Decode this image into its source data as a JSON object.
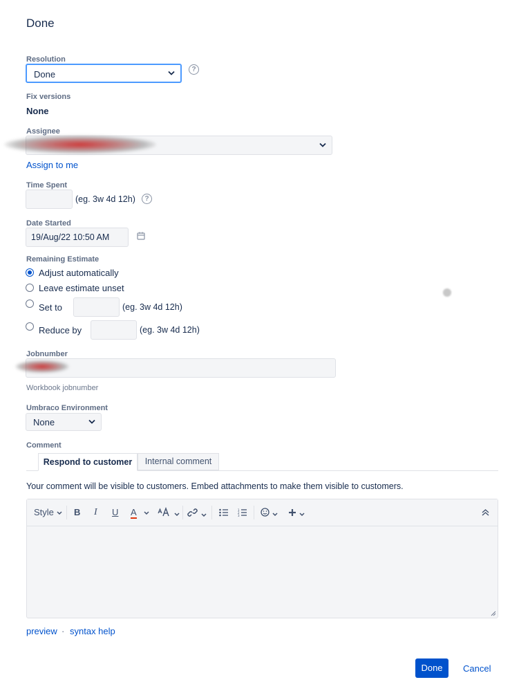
{
  "dialog": {
    "title": "Done"
  },
  "resolution": {
    "label": "Resolution",
    "value": "Done"
  },
  "fix_versions": {
    "label": "Fix versions",
    "value": "None"
  },
  "assignee": {
    "label": "Assignee",
    "assign_to_me": "Assign to me"
  },
  "time_spent": {
    "label": "Time Spent",
    "hint": "(eg. 3w 4d 12h)"
  },
  "date_started": {
    "label": "Date Started",
    "value": "19/Aug/22 10:50 AM"
  },
  "remaining_estimate": {
    "label": "Remaining Estimate",
    "options": [
      {
        "label": "Adjust automatically",
        "checked": true
      },
      {
        "label": "Leave estimate unset",
        "checked": false
      },
      {
        "label": "Set to",
        "checked": false,
        "hint": "(eg. 3w 4d 12h)"
      },
      {
        "label": "Reduce by",
        "checked": false,
        "hint": "(eg. 3w 4d 12h)"
      }
    ]
  },
  "jobnumber": {
    "label": "Jobnumber",
    "description": "Workbook jobnumber"
  },
  "umbraco": {
    "label": "Umbraco Environment",
    "value": "None"
  },
  "comment": {
    "label": "Comment",
    "tabs": [
      {
        "label": "Respond to customer",
        "active": true
      },
      {
        "label": "Internal comment",
        "active": false
      }
    ],
    "notice": "Your comment will be visible to customers. Embed attachments to make them visible to customers.",
    "toolbar": {
      "style": "Style",
      "bold": "B",
      "italic": "I",
      "underline": "U",
      "text_color": "A"
    },
    "preview": "preview",
    "separator": "·",
    "syntax_help": "syntax help"
  },
  "footer": {
    "done": "Done",
    "cancel": "Cancel"
  },
  "colors": {
    "primary": "#0052cc",
    "focus": "#4c9aff",
    "text": "#172b4d",
    "muted": "#5e6c84"
  }
}
